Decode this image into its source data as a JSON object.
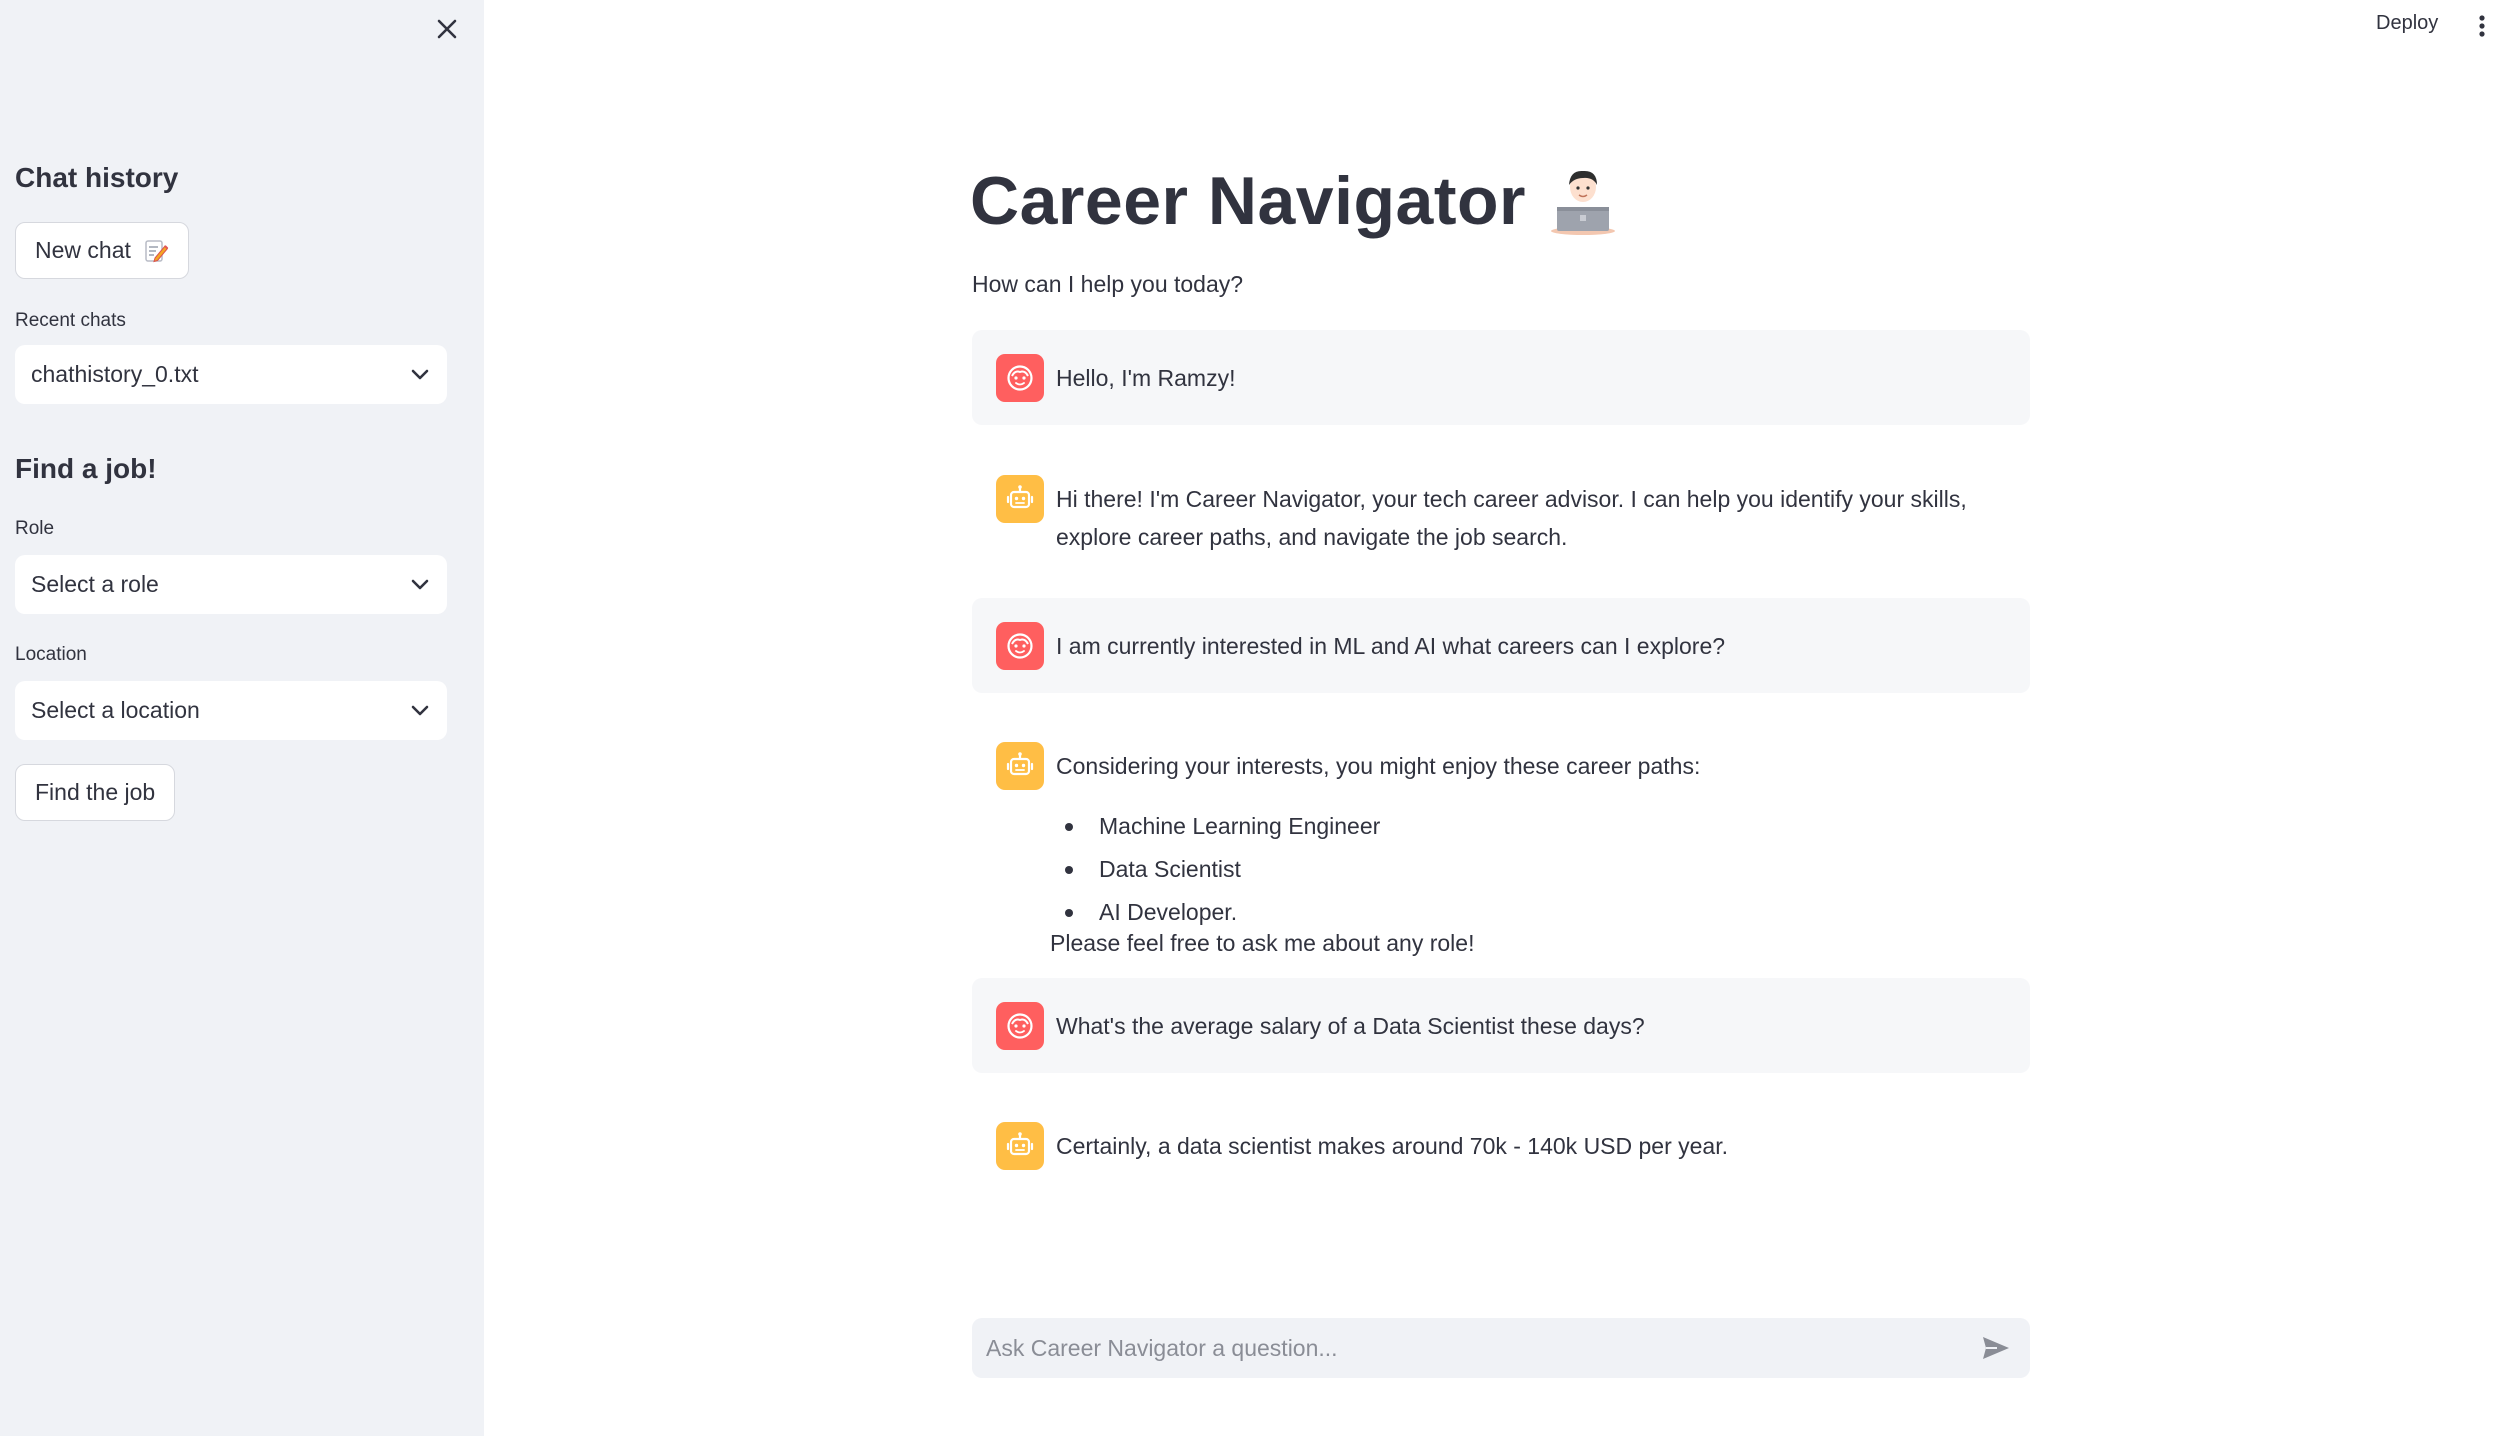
{
  "topbar": {
    "deploy_label": "Deploy"
  },
  "sidebar": {
    "chat_history_heading": "Chat history",
    "new_chat_label": "New chat",
    "recent_chats_label": "Recent chats",
    "recent_chats_value": "chathistory_0.txt",
    "find_job_heading": "Find a job!",
    "role_label": "Role",
    "role_value": "Select a role",
    "location_label": "Location",
    "location_value": "Select a location",
    "find_job_button": "Find the job"
  },
  "main": {
    "title": "Career Navigator",
    "subtitle": "How can I help you today?",
    "messages": [
      {
        "role": "user",
        "text": "Hello, I'm Ramzy!"
      },
      {
        "role": "assistant",
        "text": "Hi there! I'm Career Navigator, your tech career advisor. I can help you identify your skills, explore career paths, and navigate the job search."
      },
      {
        "role": "user",
        "text": "I am currently interested in ML and AI what careers can I explore?"
      },
      {
        "role": "assistant",
        "text": "Considering your interests, you might enjoy these career paths:"
      },
      {
        "role": "user",
        "text": "What's the average salary of a Data Scientist these days?"
      },
      {
        "role": "assistant",
        "text": "Certainly, a data scientist makes around 70k - 140k USD per year."
      }
    ],
    "career_paths": [
      "Machine Learning Engineer",
      "Data Scientist",
      "AI Developer."
    ],
    "after_list_text": "Please feel free to ask me about any role!"
  },
  "chat_input": {
    "placeholder": "Ask Career Navigator a question..."
  },
  "icons": {
    "close": "close-icon",
    "kebab": "kebab-menu-icon",
    "new_chat": "memo-icon",
    "chevron": "chevron-down-icon",
    "user_avatar": "user-face-icon",
    "bot_avatar": "robot-icon",
    "title_emoji": "technologist-icon",
    "send": "send-icon"
  },
  "colors": {
    "sidebar_bg": "#f0f2f6",
    "user_avatar": "#ff5f5f",
    "bot_avatar": "#ffbe45",
    "user_msg_bg": "#f6f7f9",
    "text": "#31333f"
  }
}
